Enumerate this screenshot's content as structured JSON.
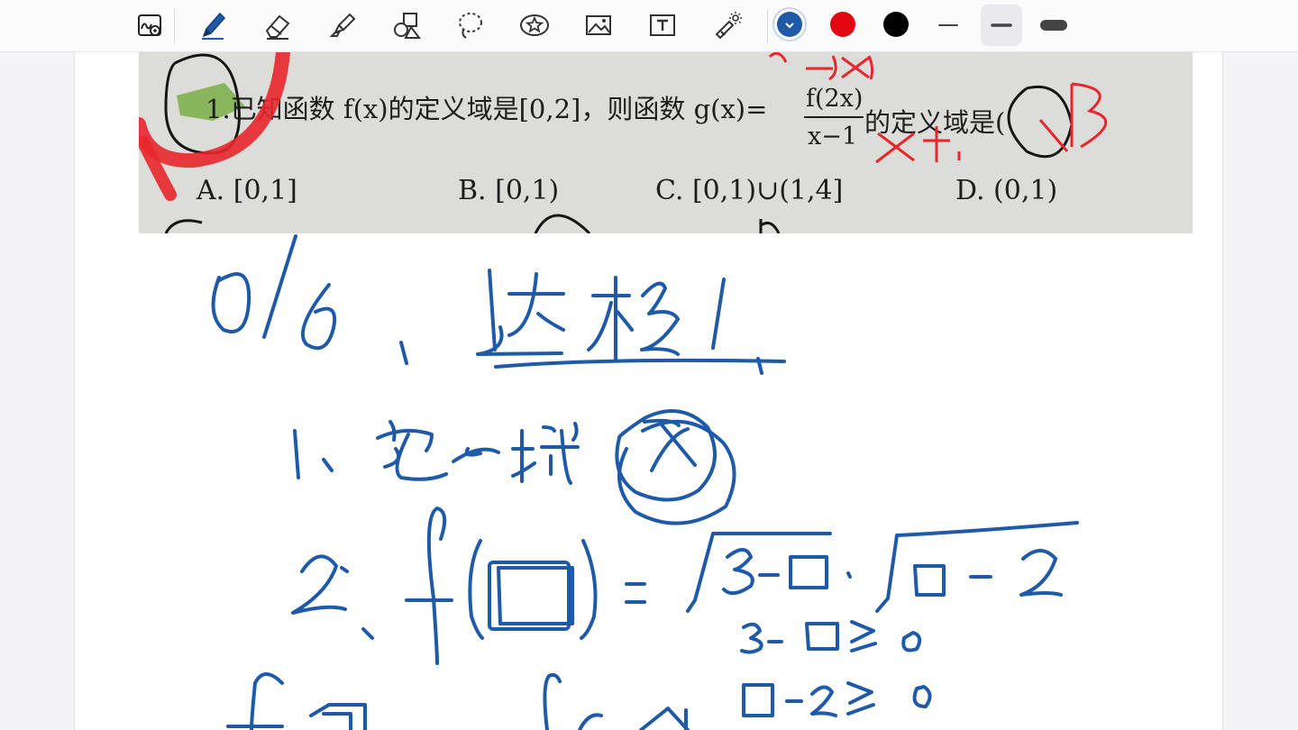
{
  "toolbar": {
    "tools": [
      {
        "id": "handwriting-zoom",
        "icon": "handwriting-zoom-icon"
      },
      {
        "id": "pen",
        "icon": "pen-icon",
        "selected": true
      },
      {
        "id": "eraser",
        "icon": "eraser-icon"
      },
      {
        "id": "highlighter",
        "icon": "highlighter-icon"
      },
      {
        "id": "shapes",
        "icon": "shapes-icon"
      },
      {
        "id": "lasso",
        "icon": "lasso-icon"
      },
      {
        "id": "sticker",
        "icon": "star-sticker-icon"
      },
      {
        "id": "image",
        "icon": "image-icon"
      },
      {
        "id": "text",
        "icon": "text-box-icon"
      },
      {
        "id": "laser-pointer",
        "icon": "laser-pointer-icon"
      }
    ],
    "colors": [
      {
        "name": "blue",
        "hex": "#1f5aa8",
        "selected": true
      },
      {
        "name": "red",
        "hex": "#e30613"
      },
      {
        "name": "black",
        "hex": "#000000"
      }
    ],
    "stroke_widths": [
      {
        "name": "thin"
      },
      {
        "name": "medium",
        "selected": true
      },
      {
        "name": "thick"
      }
    ]
  },
  "photo": {
    "stem": "1.已知函数 f(x)的定义域是[0,2]，则函数 g(x)=",
    "numerator": "f(2x)",
    "denominator": "x−1",
    "tail": "的定义域是(",
    "options": [
      "A.  [0,1]",
      "B.  [0,1)",
      "C.  [0,1)∪(1,4]",
      "D.  (0,1)"
    ]
  },
  "ink_colors": {
    "blue": "#1f5aa8",
    "red": "#e8262d",
    "photo_ink": "#151515",
    "highlight": "#7aae47"
  }
}
